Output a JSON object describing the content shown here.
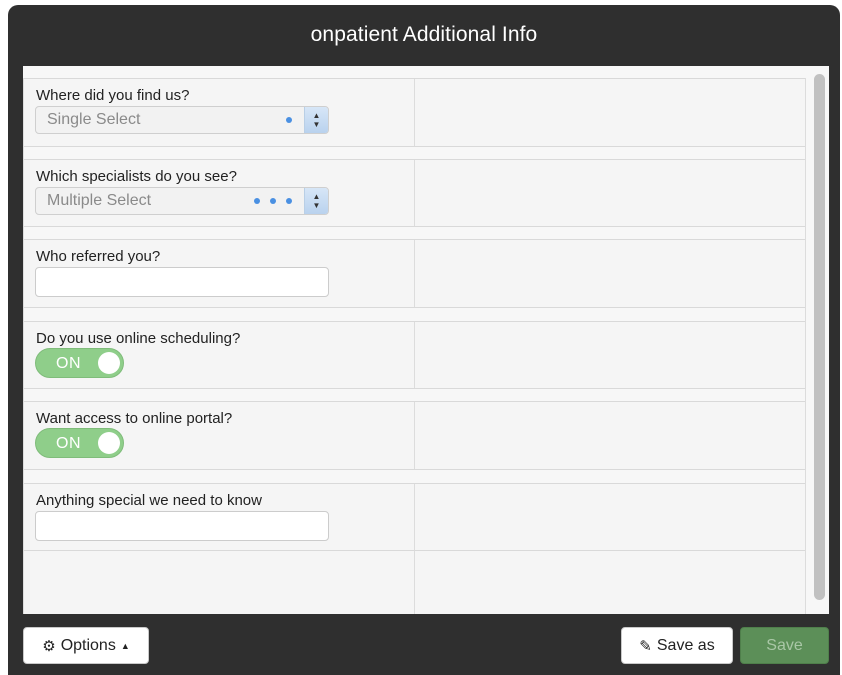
{
  "window": {
    "title": "onpatient Additional Info"
  },
  "fields": {
    "find_us": {
      "label": "Where did you find us?",
      "value": "Single Select"
    },
    "specialists": {
      "label": "Which specialists do you see?",
      "value": "Multiple Select"
    },
    "referred": {
      "label": "Who referred you?",
      "value": ""
    },
    "online_scheduling": {
      "label": "Do you use online scheduling?",
      "toggle": "ON"
    },
    "portal": {
      "label": "Want access to online portal?",
      "toggle": "ON"
    },
    "special": {
      "label": "Anything special we need to know",
      "value": ""
    }
  },
  "footer": {
    "options_label": "Options",
    "save_as_label": "Save as",
    "save_label": "Save"
  },
  "colors": {
    "toggle_on": "#8fce8a",
    "save_button": "#5c8f58",
    "accent_dot": "#4a90e2"
  }
}
